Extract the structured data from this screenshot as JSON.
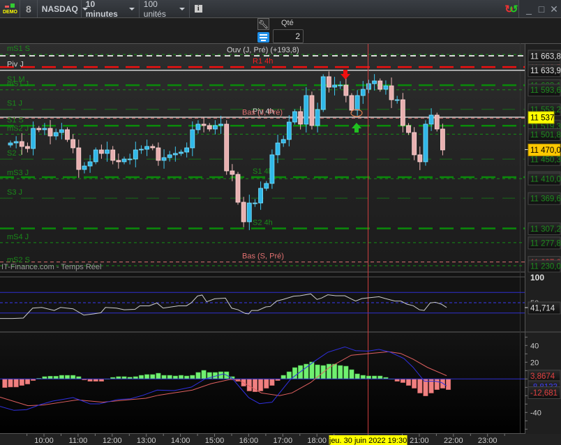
{
  "toolbar": {
    "demo_label": "DEMO",
    "instrument": "NASDAQ",
    "timeframe": "10 minutes",
    "units": "100 unités",
    "info_icon": "info-icon",
    "link_icon": "chain-link-icon"
  },
  "order_panel": {
    "qty_label": "Qté",
    "qty_value": "2"
  },
  "colors": {
    "bull": "#3ec8f0",
    "bear": "#f0b8b8",
    "level_green": "#0e8a0e",
    "crosshair": "#d04040",
    "rsi": "#cccccc",
    "macd": "#3030e0",
    "signal": "#e06060",
    "hist_pos": "#70f070",
    "hist_neg": "#f08080"
  },
  "price_chart": {
    "watermark": "IT-Finance.com - Temps Réel",
    "first_open": 11479.4,
    "closes": [
      11483.7,
      11486.6,
      11476.5,
      11472.2,
      11513.9,
      11511.1,
      11513.9,
      11498.1,
      11505.3,
      11511.1,
      11490.9,
      11473.6,
      11428.9,
      11436.1,
      11444.8,
      11469.3,
      11462.1,
      11469.3,
      11447.7,
      11444.8,
      11450.5,
      11450.5,
      11469.3,
      11470.7,
      11476.5,
      11473.6,
      11447.7,
      11453.4,
      11459.2,
      11462.1,
      11464.9,
      11473.6,
      11511.1,
      11522.6,
      11519.7,
      11512.5,
      11519.7,
      11522.6,
      11426.0,
      11418.8,
      11361.2,
      11320.8,
      11359.7,
      11359.7,
      11390.0,
      11400.1,
      11459.2,
      11483.7,
      11490.9,
      11526.9,
      11548.5,
      11522.6,
      11581.7,
      11519.7,
      11552.8,
      11620.6,
      11599.0,
      11603.3,
      11603.3,
      11581.7,
      11551.4,
      11581.7,
      11594.6,
      11606.2,
      11611.9,
      11594.6,
      11601.8,
      11573.0,
      11573.0,
      11519.7,
      11505.3,
      11459.2,
      11444.8,
      11522.6,
      11541.3,
      11512.5,
      11469.3
    ],
    "levels": [
      {
        "name": "mS1 S",
        "price": 11666.5,
        "style": "thin",
        "label": "mS1 S",
        "label_pos": "left"
      },
      {
        "name": "Ouv (J, Pré)",
        "price": 11663.8,
        "style": "white-dash",
        "label": "Ouv (J, Pré) (+193,8)",
        "label_pos": "mid",
        "axis": "11 663,8",
        "axis_style": "white"
      },
      {
        "name": "R1 4h",
        "price": 11640.5,
        "style": "red",
        "label": "R1 4h",
        "label_pos": "mid",
        "axis": "11 640,5",
        "axis_style": "red"
      },
      {
        "name": "Piv J",
        "price": 11633.9,
        "style": "white-solid",
        "label": "Piv J",
        "label_pos": "left",
        "axis": "11 633,9",
        "axis_style": "white"
      },
      {
        "name": "S1 M",
        "price": 11603.1,
        "style": "thick",
        "label": "S1 M",
        "label_pos": "left",
        "axis": "11 603,1",
        "axis_style": "green"
      },
      {
        "name": "mS1 J",
        "price": 11593.6,
        "style": "thin",
        "label": "mS1 J",
        "label_pos": "left",
        "axis": "11 593,6",
        "axis_style": "green"
      },
      {
        "name": "S1 J",
        "price": 11553.2,
        "style": "long",
        "label": "S1 J",
        "label_pos": "left",
        "axis": "11 553,2",
        "axis_style": "green"
      },
      {
        "name": "Piv 4h",
        "price": 11537.0,
        "style": "white-solid",
        "label": "Piv 4h",
        "label_pos": "mid2"
      },
      {
        "name": "Bas (J, Pré)",
        "price": 11535.0,
        "style": "pink",
        "label": "Bas (J, Pré)",
        "label_pos": "mid"
      },
      {
        "name": "S1 S",
        "price": 11519.3,
        "style": "thick",
        "label": "S1 S",
        "label_pos": "left",
        "axis": "11 519,3",
        "axis_style": "green"
      },
      {
        "name": "mS2 J",
        "price": 11501.8,
        "style": "thin",
        "label": "mS2 J",
        "label_pos": "left",
        "axis": "11 501,8",
        "axis_style": "green"
      },
      {
        "name": "S2 J",
        "price": 11450.3,
        "style": "long",
        "label": "S2 J",
        "label_pos": "left",
        "axis": "11 450,3",
        "axis_style": "green"
      },
      {
        "name": "S1 4h",
        "price": 11413.0,
        "style": "thick",
        "label": "S1 4h",
        "label_pos": "mid2",
        "axis": "11 413,0",
        "axis_style": "green"
      },
      {
        "name": "mS3 J",
        "price": 11410.0,
        "style": "thin",
        "label": "mS3 J",
        "label_pos": "left",
        "axis": "11 410,0",
        "axis_style": "green"
      },
      {
        "name": "S3 J",
        "price": 11369.6,
        "style": "long",
        "label": "S3 J",
        "label_pos": "left",
        "axis": "11 369,6",
        "axis_style": "green"
      },
      {
        "name": "S2 4h",
        "price": 11307.2,
        "style": "thick",
        "label": "S2 4h",
        "label_pos": "mid2",
        "axis": "11 307,2",
        "axis_style": "green"
      },
      {
        "name": "mS4 J",
        "price": 11277.8,
        "style": "thin",
        "label": "mS4 J",
        "label_pos": "left",
        "axis": "11 277,8",
        "axis_style": "green"
      },
      {
        "name": "Bas (S, Pré)",
        "price": 11237.8,
        "style": "pink",
        "label": "Bas (S, Pré)",
        "label_pos": "mid",
        "axis": "11 237,8",
        "axis_style": "red"
      },
      {
        "name": "mS2 S",
        "price": 11230.0,
        "style": "thin",
        "label": "mS2 S",
        "label_pos": "left",
        "axis": "11 230,0",
        "axis_style": "green"
      }
    ],
    "crosshair_price": "11 537",
    "last_price": "11 470,0",
    "last_price_value": 11470.0,
    "signals": [
      {
        "type": "sell-arrow",
        "index": 59
      },
      {
        "type": "buy-arrow",
        "index": 61
      }
    ]
  },
  "rsi": {
    "axis_max": "100",
    "axis_mid": "50",
    "current": "41,714",
    "points": [
      [
        -1.84,
        19.4
      ],
      [
        0.35,
        19.4
      ],
      [
        2.26,
        20.3
      ],
      [
        3.9,
        39.5
      ],
      [
        5.5,
        40.8
      ],
      [
        7.7,
        35
      ],
      [
        8.8,
        40.8
      ],
      [
        11.0,
        38.2
      ],
      [
        12.9,
        26
      ],
      [
        14.6,
        28.4
      ],
      [
        15.9,
        30.6
      ],
      [
        16.7,
        40.8
      ],
      [
        18.65,
        39.5
      ],
      [
        20.0,
        36.4
      ],
      [
        21.9,
        37.2
      ],
      [
        22.75,
        44
      ],
      [
        24.4,
        44
      ],
      [
        25.75,
        49.5
      ],
      [
        26.85,
        39.5
      ],
      [
        29.6,
        44
      ],
      [
        30.95,
        44
      ],
      [
        31.8,
        49.9
      ],
      [
        32.9,
        63
      ],
      [
        33.7,
        64.9
      ],
      [
        34.5,
        51.8
      ],
      [
        35.9,
        57.6
      ],
      [
        37.8,
        59
      ],
      [
        38.9,
        39.5
      ],
      [
        40.0,
        36.4
      ],
      [
        41.3,
        29.2
      ],
      [
        41.9,
        28.4
      ],
      [
        42.4,
        35
      ],
      [
        43.5,
        35
      ],
      [
        44.9,
        41.9
      ],
      [
        45.7,
        42.8
      ],
      [
        46.8,
        53.2
      ],
      [
        47.9,
        56.3
      ],
      [
        49.8,
        62.6
      ],
      [
        50.9,
        63.5
      ],
      [
        52.8,
        67.1
      ],
      [
        53.9,
        56.3
      ],
      [
        54.7,
        59
      ],
      [
        55.8,
        65.3
      ],
      [
        57.2,
        63.5
      ],
      [
        58.8,
        63.5
      ],
      [
        60.7,
        53.2
      ],
      [
        61.8,
        58.1
      ],
      [
        64.8,
        61.7
      ],
      [
        65.9,
        58.1
      ],
      [
        67.6,
        53.2
      ],
      [
        68.65,
        53.2
      ],
      [
        69.7,
        47.3
      ],
      [
        70.85,
        44
      ],
      [
        71.9,
        36.4
      ],
      [
        72.75,
        35
      ],
      [
        73.8,
        49.5
      ],
      [
        74.7,
        50.9
      ],
      [
        75.75,
        47.3
      ],
      [
        76.7,
        40.8
      ]
    ]
  },
  "macd": {
    "ticks": [
      "40",
      "20",
      "-40"
    ],
    "tick_values": [
      40,
      20,
      -40
    ],
    "signal_current": "3,8674",
    "macd_current": "-8,8133",
    "hist_current": "-12,681",
    "hist_start_index": -1,
    "histogram": [
      -10.3,
      -9.7,
      -9.7,
      -7.8,
      -6.1,
      -1.9,
      0.8,
      2.8,
      3.3,
      3.3,
      4.4,
      4.4,
      4.4,
      2.8,
      -1.1,
      -2.8,
      -2.8,
      -2.8,
      0,
      1.9,
      2.8,
      2.8,
      2.2,
      2.8,
      4.4,
      5.3,
      5.3,
      6.9,
      4.4,
      4.4,
      3.6,
      4.4,
      3.6,
      4.4,
      7.8,
      10.3,
      7.8,
      7.8,
      8.6,
      8.6,
      2.8,
      -2.8,
      -8.6,
      -14.4,
      -15.3,
      -14.4,
      -11.1,
      -7.8,
      -1.9,
      4.4,
      8.6,
      13.6,
      16.1,
      17.8,
      20.3,
      16.9,
      16.1,
      17.8,
      17.8,
      16.1,
      15.3,
      11.1,
      6.1,
      4.4,
      3.6,
      3.6,
      3.6,
      1.9,
      0,
      -2.8,
      -4.4,
      -7.8,
      -11.1,
      -16.9,
      -20.3,
      -16.9,
      -12.8,
      -11.1,
      -12.8
    ],
    "macd_line": [
      [
        -1.84,
        -32.8
      ],
      [
        0.62,
        -37.5
      ],
      [
        2.81,
        -36.7
      ],
      [
        5.27,
        -30.6
      ],
      [
        7.45,
        -26.4
      ],
      [
        9.1,
        -24.5
      ],
      [
        11.0,
        -22.3
      ],
      [
        12.4,
        -25.6
      ],
      [
        14.0,
        -29.8
      ],
      [
        15.65,
        -29.8
      ],
      [
        18.9,
        -24.5
      ],
      [
        21.1,
        -23.7
      ],
      [
        23.3,
        -19.5
      ],
      [
        25.8,
        -13.3
      ],
      [
        28.8,
        -13.9
      ],
      [
        31.8,
        -9.75
      ],
      [
        34.2,
        0
      ],
      [
        37.5,
        6.1
      ],
      [
        38.9,
        1.4
      ],
      [
        41.9,
        -22.3
      ],
      [
        43.8,
        -29.5
      ],
      [
        46.0,
        -27.8
      ],
      [
        49.3,
        0
      ],
      [
        53.4,
        20.8
      ],
      [
        55.8,
        31.9
      ],
      [
        58.8,
        38.3
      ],
      [
        60.7,
        33.8
      ],
      [
        62.9,
        33.3
      ],
      [
        64.8,
        35.3
      ],
      [
        66.8,
        31.9
      ],
      [
        69.2,
        24.4
      ],
      [
        70.8,
        13.9
      ],
      [
        72.8,
        -2.8
      ],
      [
        74.7,
        -2.8
      ],
      [
        75.8,
        -4.2
      ],
      [
        76.7,
        -8.3
      ]
    ],
    "signal_line": [
      [
        -1.84,
        -21.7
      ],
      [
        3.08,
        -31.9
      ],
      [
        5.8,
        -31.1
      ],
      [
        9.6,
        -27.2
      ],
      [
        11.8,
        -25
      ],
      [
        16.2,
        -27.8
      ],
      [
        20.6,
        -25
      ],
      [
        23.8,
        -23.1
      ],
      [
        26.0,
        -19.5
      ],
      [
        32.0,
        -13.3
      ],
      [
        35.3,
        -5.6
      ],
      [
        38.6,
        -0.6
      ],
      [
        40.2,
        -1.4
      ],
      [
        44.1,
        -16.7
      ],
      [
        47.3,
        -20
      ],
      [
        49.5,
        -16.7
      ],
      [
        52.8,
        -4.2
      ],
      [
        56.1,
        13.9
      ],
      [
        59.9,
        28.3
      ],
      [
        62.6,
        30
      ],
      [
        66.5,
        32.5
      ],
      [
        68.6,
        30.5
      ],
      [
        70.8,
        23.6
      ],
      [
        73.3,
        13.9
      ],
      [
        76.7,
        3.9
      ]
    ]
  },
  "time_axis": {
    "labels": [
      {
        "text": "10:00",
        "hour": 10
      },
      {
        "text": "11:00",
        "hour": 11
      },
      {
        "text": "12:00",
        "hour": 12
      },
      {
        "text": "13:00",
        "hour": 13
      },
      {
        "text": "14:00",
        "hour": 14
      },
      {
        "text": "15:00",
        "hour": 15
      },
      {
        "text": "16:00",
        "hour": 16
      },
      {
        "text": "17:00",
        "hour": 17
      },
      {
        "text": "18:00",
        "hour": 18
      },
      {
        "text": "21:00",
        "hour": 21
      },
      {
        "text": "22:00",
        "hour": 22
      },
      {
        "text": "23:00",
        "hour": 23
      }
    ],
    "crosshair_label": "jeu. 30 juin 2022 19:30",
    "crosshair_hour": 19.5
  }
}
